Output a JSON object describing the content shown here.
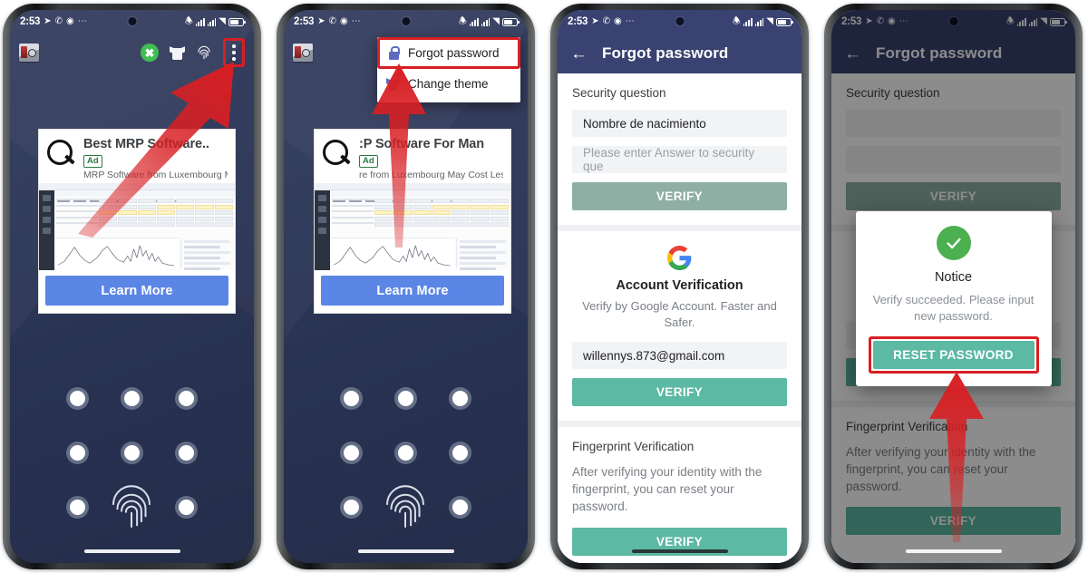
{
  "status_bar": {
    "time": "2:53",
    "left_icons": [
      "telegram-icon",
      "whatsapp-icon",
      "app-icon",
      "more-dots"
    ],
    "right_icons": [
      "silent-icon",
      "signal-1",
      "signal-2",
      "wifi-icon",
      "battery-icon"
    ]
  },
  "phone1": {
    "toolbar": {
      "app_icon": "vault-icon",
      "icons": [
        "boost-icon",
        "theme-shirt-icon",
        "fingerprint-icon",
        "overflow-menu-icon"
      ]
    },
    "ad": {
      "title": "Best MRP Software..",
      "badge": "Ad",
      "subtitle": "MRP Software from Luxembourg M..",
      "cta": "Learn More"
    },
    "lock": {
      "pattern_dots": 8,
      "fingerprint": "fingerprint-unlock-icon"
    }
  },
  "phone2": {
    "ad": {
      "title": ":P Software For Man",
      "badge": "Ad",
      "subtitle": "re from Luxembourg May Cost Less",
      "cta": "Learn More"
    },
    "menu": {
      "items": [
        {
          "label": "Forgot password",
          "icon": "lock-icon",
          "highlighted": true
        },
        {
          "label": "Change theme",
          "icon": "shirt-icon",
          "highlighted": false
        }
      ]
    }
  },
  "phone3": {
    "appbar": {
      "back": "←",
      "title": "Forgot password"
    },
    "security_question": {
      "label": "Security question",
      "question": "Nombre de nacimiento",
      "answer_placeholder": "Please enter Answer to security que",
      "verify": "VERIFY"
    },
    "google": {
      "logo": "google-g-icon",
      "title": "Account Verification",
      "desc": "Verify by Google Account. Faster and Safer.",
      "email": "willennys.873@gmail.com",
      "verify": "VERIFY"
    },
    "fingerprint": {
      "title": "Fingerprint Verification",
      "desc": "After verifying your identity with the fingerprint, you can reset your password.",
      "verify": "VERIFY"
    }
  },
  "phone4": {
    "appbar": {
      "back": "←",
      "title": "Forgot password"
    },
    "security_question": {
      "label": "Security question",
      "verify": "VERIFY"
    },
    "google": {
      "verify": "VERIFY"
    },
    "fingerprint": {
      "title": "Fingerprint Verification",
      "desc": "After verifying your identity with the fingerprint, you can reset your password.",
      "verify": "VERIFY"
    },
    "dialog": {
      "icon": "success-check-icon",
      "title": "Notice",
      "message": "Verify succeeded. Please input new password.",
      "button": "RESET PASSWORD"
    }
  },
  "colors": {
    "appbar": "#394270",
    "lock_bg": "#2b3555",
    "btn_muted": "#8fafa4",
    "btn_active": "#5cb9a3",
    "highlight_red": "#d81f23",
    "ad_cta_blue": "#5b86e5",
    "success_green": "#4caf50"
  }
}
